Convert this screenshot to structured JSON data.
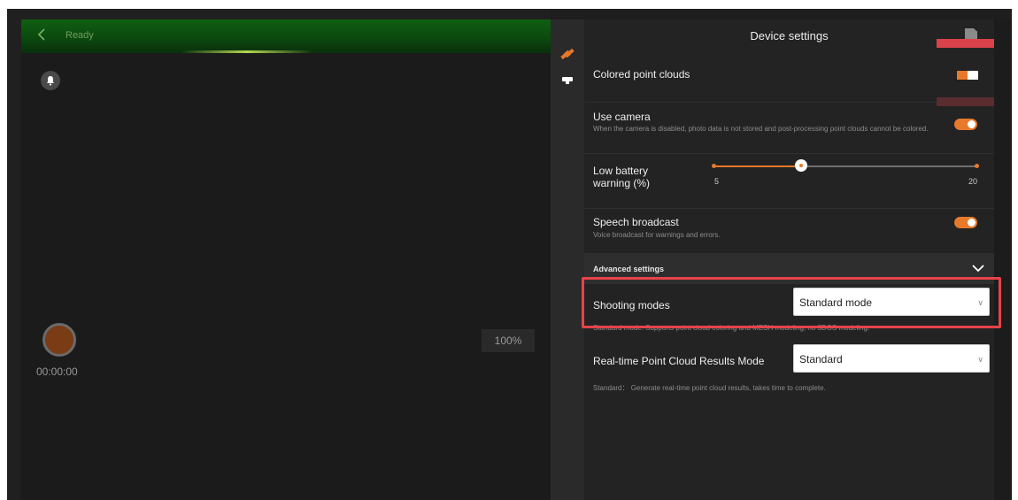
{
  "camera": {
    "status": "Ready",
    "record_time": "00:00:00",
    "zoom": "100%"
  },
  "rail": {
    "icons": [
      "satellite-icon",
      "device-icon"
    ]
  },
  "settings": {
    "title": "Device settings",
    "colored_point_clouds": {
      "label": "Colored point clouds",
      "enabled": true
    },
    "use_camera": {
      "label": "Use camera",
      "desc": "When the camera is disabled, photo data is not stored and post-processing point clouds cannot be colored.",
      "enabled": true
    },
    "low_battery": {
      "label_line1": "Low battery",
      "label_line2": "warning (%)",
      "min_label": "5",
      "max_label": "20",
      "min": 5,
      "max": 20,
      "value": 10
    },
    "speech": {
      "label": "Speech broadcast",
      "desc": "Voice broadcast for warnings and errors.",
      "enabled": true
    },
    "advanced": {
      "label": "Advanced settings"
    },
    "shooting_modes": {
      "label": "Shooting modes",
      "value": "Standard mode",
      "desc": "Standard mode: Supports point cloud coloring and MESH modeling, no 3DGS modeling."
    },
    "realtime": {
      "label": "Real-time Point Cloud Results Mode",
      "value": "Standard",
      "desc": "Standard： Generate real-time point cloud results, takes time to complete."
    }
  },
  "colors": {
    "accent": "#e8792a",
    "highlight": "#e8424a",
    "topbar": "#0f5f12"
  }
}
